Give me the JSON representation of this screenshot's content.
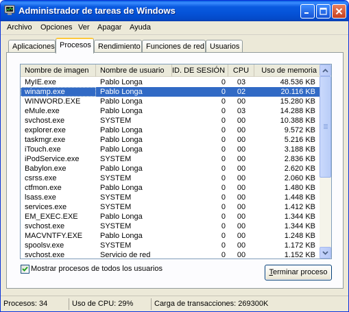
{
  "window": {
    "title": "Administrador de tareas de Windows"
  },
  "menu": [
    "Archivo",
    "Opciones",
    "Ver",
    "Apagar",
    "Ayuda"
  ],
  "tabs": [
    "Aplicaciones",
    "Procesos",
    "Rendimiento",
    "Funciones de red",
    "Usuarios"
  ],
  "active_tab": "Procesos",
  "table": {
    "columns": [
      "Nombre de imagen",
      "Nombre de usuario",
      "ID. DE SESIÓN",
      "CPU",
      "Uso de memoria"
    ],
    "selected_row": "winamp.exe",
    "rows": [
      [
        "MyIE.exe",
        "Pablo Longa",
        "0",
        "03",
        "48.536 KB"
      ],
      [
        "winamp.exe",
        "Pablo Longa",
        "0",
        "02",
        "20.116 KB"
      ],
      [
        "WINWORD.EXE",
        "Pablo Longa",
        "0",
        "00",
        "15.280 KB"
      ],
      [
        "eMule.exe",
        "Pablo Longa",
        "0",
        "03",
        "14.288 KB"
      ],
      [
        "svchost.exe",
        "SYSTEM",
        "0",
        "00",
        "10.388 KB"
      ],
      [
        "explorer.exe",
        "Pablo Longa",
        "0",
        "00",
        "9.572 KB"
      ],
      [
        "taskmgr.exe",
        "Pablo Longa",
        "0",
        "00",
        "5.216 KB"
      ],
      [
        "iTouch.exe",
        "Pablo Longa",
        "0",
        "00",
        "3.188 KB"
      ],
      [
        "iPodService.exe",
        "SYSTEM",
        "0",
        "00",
        "2.836 KB"
      ],
      [
        "Babylon.exe",
        "Pablo Longa",
        "0",
        "00",
        "2.620 KB"
      ],
      [
        "csrss.exe",
        "SYSTEM",
        "0",
        "00",
        "2.060 KB"
      ],
      [
        "ctfmon.exe",
        "Pablo Longa",
        "0",
        "00",
        "1.480 KB"
      ],
      [
        "lsass.exe",
        "SYSTEM",
        "0",
        "00",
        "1.448 KB"
      ],
      [
        "services.exe",
        "SYSTEM",
        "0",
        "00",
        "1.412 KB"
      ],
      [
        "EM_EXEC.EXE",
        "Pablo Longa",
        "0",
        "00",
        "1.344 KB"
      ],
      [
        "svchost.exe",
        "SYSTEM",
        "0",
        "00",
        "1.344 KB"
      ],
      [
        "MACVNTFY.EXE",
        "Pablo Longa",
        "0",
        "00",
        "1.248 KB"
      ],
      [
        "spoolsv.exe",
        "SYSTEM",
        "0",
        "00",
        "1.172 KB"
      ],
      [
        "svchost.exe",
        "Servicio de red",
        "0",
        "00",
        "1.152 KB"
      ]
    ]
  },
  "show_all_users": {
    "label": "Mostrar procesos de todos los usuarios",
    "checked": true
  },
  "end_process": {
    "accel": "T",
    "rest": "erminar proceso"
  },
  "status": {
    "processes": "Procesos: 34",
    "cpu": "Uso de CPU: 29%",
    "commit": "Carga de transacciones: 269300K"
  },
  "colors": {
    "titlebar": "#0553d8",
    "selection": "#316ac5",
    "active_tab_accent": "#ffc83c",
    "close_button": "#c7401f"
  },
  "icons": [
    "task-manager-icon",
    "minimize-icon",
    "maximize-icon",
    "close-icon",
    "scroll-up-icon",
    "scroll-down-icon",
    "checkmark-icon"
  ]
}
